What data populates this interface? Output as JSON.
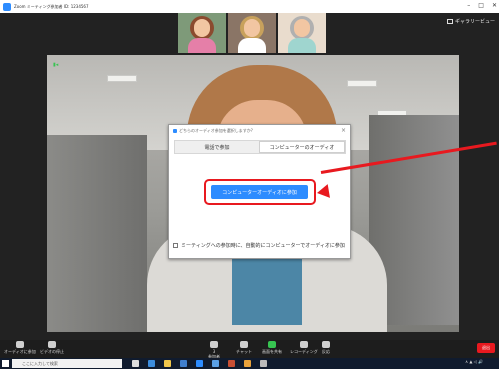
{
  "window": {
    "title": "Zoom ミーティング参加者 ID: 1234567"
  },
  "view_button": {
    "label": "ギャラリービュー"
  },
  "participants": [
    {
      "name": "female-cartoon"
    },
    {
      "name": "doctor-photo"
    },
    {
      "name": "elderly-cartoon"
    }
  ],
  "dialog": {
    "title": "どちらのオーディオ参加を選択しますか?",
    "tabs": [
      "電話で参加",
      "コンピューターのオーディオ"
    ],
    "join_button": "コンピューターオーディオに参加",
    "auto_join_label": "ミーティングへの参加時に、自動的にコンピューターでオーディオに参加"
  },
  "toolbar": {
    "audio": "オーディオに参加",
    "video": "ビデオの停止",
    "participants": "参加者",
    "participants_count": "3",
    "chat": "チャット",
    "share": "画面を共有",
    "record": "レコーディング",
    "reactions": "反応",
    "end": "退出"
  },
  "taskbar": {
    "search_placeholder": "ここに入力して検索"
  },
  "colors": {
    "accent": "#2d8cff",
    "highlight": "#e8191f",
    "active": "#37c451"
  }
}
